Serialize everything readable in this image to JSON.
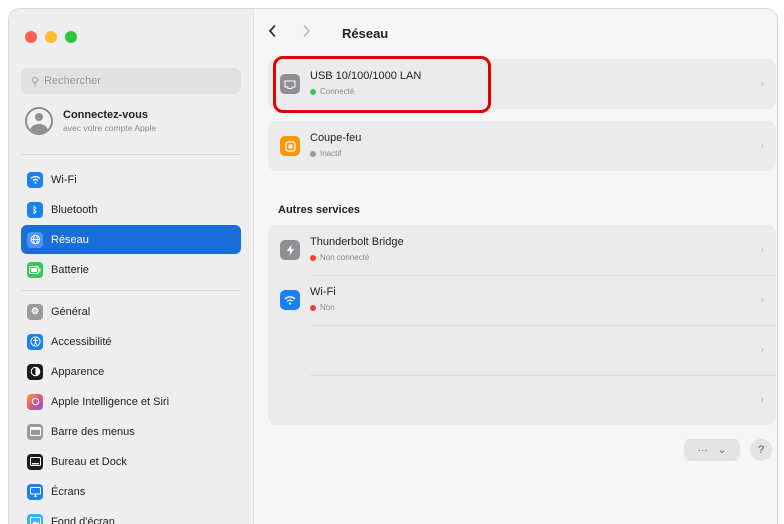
{
  "search": {
    "placeholder": "Rechercher"
  },
  "account": {
    "title": "Connectez-vous",
    "subtitle": "avec votre compte Apple"
  },
  "sidebar": {
    "items": [
      {
        "label": "Wi-Fi",
        "icon": "wifi-icon",
        "color": "#1a82f0"
      },
      {
        "label": "Bluetooth",
        "icon": "bluetooth-icon",
        "color": "#1a82f0"
      },
      {
        "label": "Réseau",
        "icon": "globe-icon",
        "color": "#1a82f0",
        "selected": true
      },
      {
        "label": "Batterie",
        "icon": "battery-icon",
        "color": "#34c759"
      },
      {
        "label": "Général",
        "icon": "gear-icon",
        "color": "#9a9a9a"
      },
      {
        "label": "Accessibilité",
        "icon": "accessibility-icon",
        "color": "#1a82f0"
      },
      {
        "label": "Apparence",
        "icon": "appearance-icon",
        "color": "#1c1c1c"
      },
      {
        "label": "Apple Intelligence et Siri",
        "icon": "siri-icon",
        "color": "#e4507a"
      },
      {
        "label": "Barre des menus",
        "icon": "menubar-icon",
        "color": "#9a9a9a"
      },
      {
        "label": "Bureau et Dock",
        "icon": "dock-icon",
        "color": "#1c1c1c"
      },
      {
        "label": "Écrans",
        "icon": "display-icon",
        "color": "#1a82f0"
      },
      {
        "label": "Fond d'écran",
        "icon": "wallpaper-icon",
        "color": "#3ab0f5"
      }
    ]
  },
  "main": {
    "title": "Réseau",
    "services": [
      {
        "name": "USB 10/100/1000 LAN",
        "status": "Connecté",
        "status_color": "#34c759",
        "icon": "ethernet-icon",
        "icon_color": "#8e8e93"
      },
      {
        "name": "Coupe-feu",
        "status": "Inactif",
        "status_color": "#9a9a9a",
        "icon": "firewall-icon",
        "icon_color": "#ff9500"
      }
    ],
    "other_label": "Autres services",
    "other_services": [
      {
        "name": "Thunderbolt Bridge",
        "status": "Non connecté",
        "status_color": "#ff3b30",
        "icon": "thunderbolt-icon",
        "icon_color": "#8e8e93"
      },
      {
        "name": "Wi-Fi",
        "status": "Non",
        "status_color": "#ff3b30",
        "icon": "wifi-icon",
        "icon_color": "#1a82f0"
      }
    ],
    "actions": {
      "more": "···",
      "menu": "⌄",
      "help": "?"
    }
  },
  "colors": {
    "accent": "#1a6ed8",
    "highlight": "#e00000"
  }
}
